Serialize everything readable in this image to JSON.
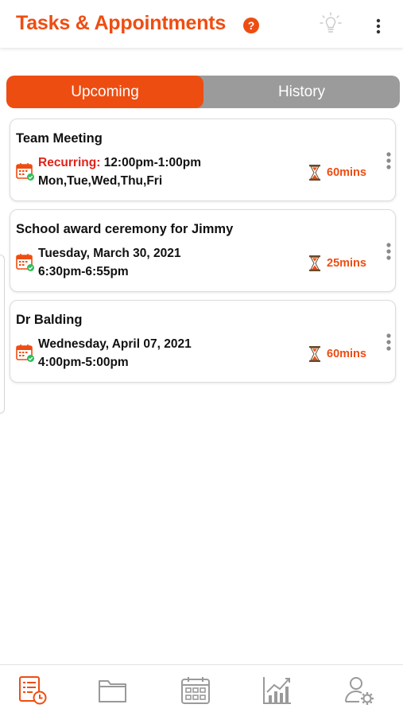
{
  "header": {
    "title": "Tasks & Appointments",
    "help_glyph": "?",
    "icons": [
      "help-icon",
      "lightbulb-icon",
      "more-vertical-icon"
    ]
  },
  "tabs": {
    "active": "Upcoming",
    "inactive": "History"
  },
  "colors": {
    "brand": "#ee4d12",
    "recurring": "#e0231b",
    "tab_inactive_bg": "#9b9b9b",
    "calendar_check": "#2ebd59"
  },
  "appointments": [
    {
      "title": "Team Meeting",
      "recurring_label": "Recurring:",
      "line1": "12:00pm-1:00pm",
      "line2": "Mon,Tue,Wed,Thu,Fri",
      "duration": "60mins"
    },
    {
      "title": "School award ceremony for Jimmy",
      "line1": "Tuesday, March 30, 2021",
      "line2": "6:30pm-6:55pm",
      "duration": "25mins"
    },
    {
      "title": "Dr Balding",
      "line1": "Wednesday, April 07, 2021",
      "line2": "4:00pm-5:00pm",
      "duration": "60mins"
    }
  ],
  "bottom_nav": {
    "items": [
      "tasks-icon",
      "folder-icon",
      "calendar-icon",
      "chart-icon",
      "user-settings-icon"
    ],
    "active": "tasks-icon"
  }
}
